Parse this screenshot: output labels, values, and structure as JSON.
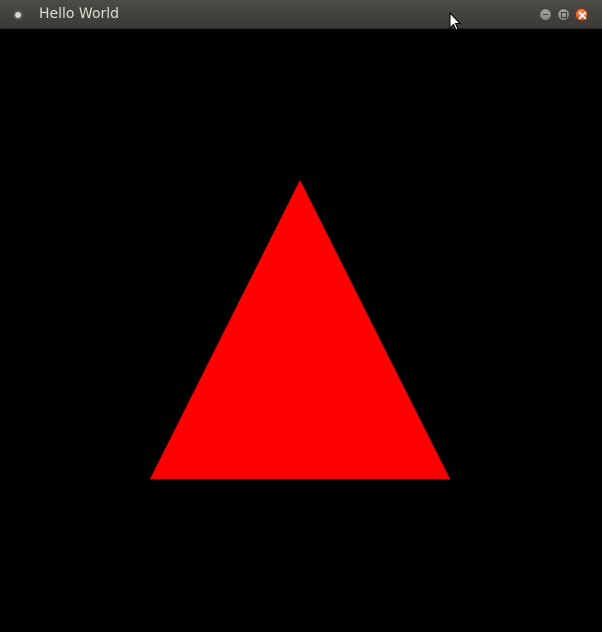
{
  "window": {
    "title": "Hello World",
    "buttons": {
      "minimize": "minimize-icon",
      "maximize": "maximize-icon",
      "close": "close-icon"
    }
  },
  "scene": {
    "background_color": "#000000",
    "shape": "triangle",
    "fill_color": "#ff0000"
  }
}
